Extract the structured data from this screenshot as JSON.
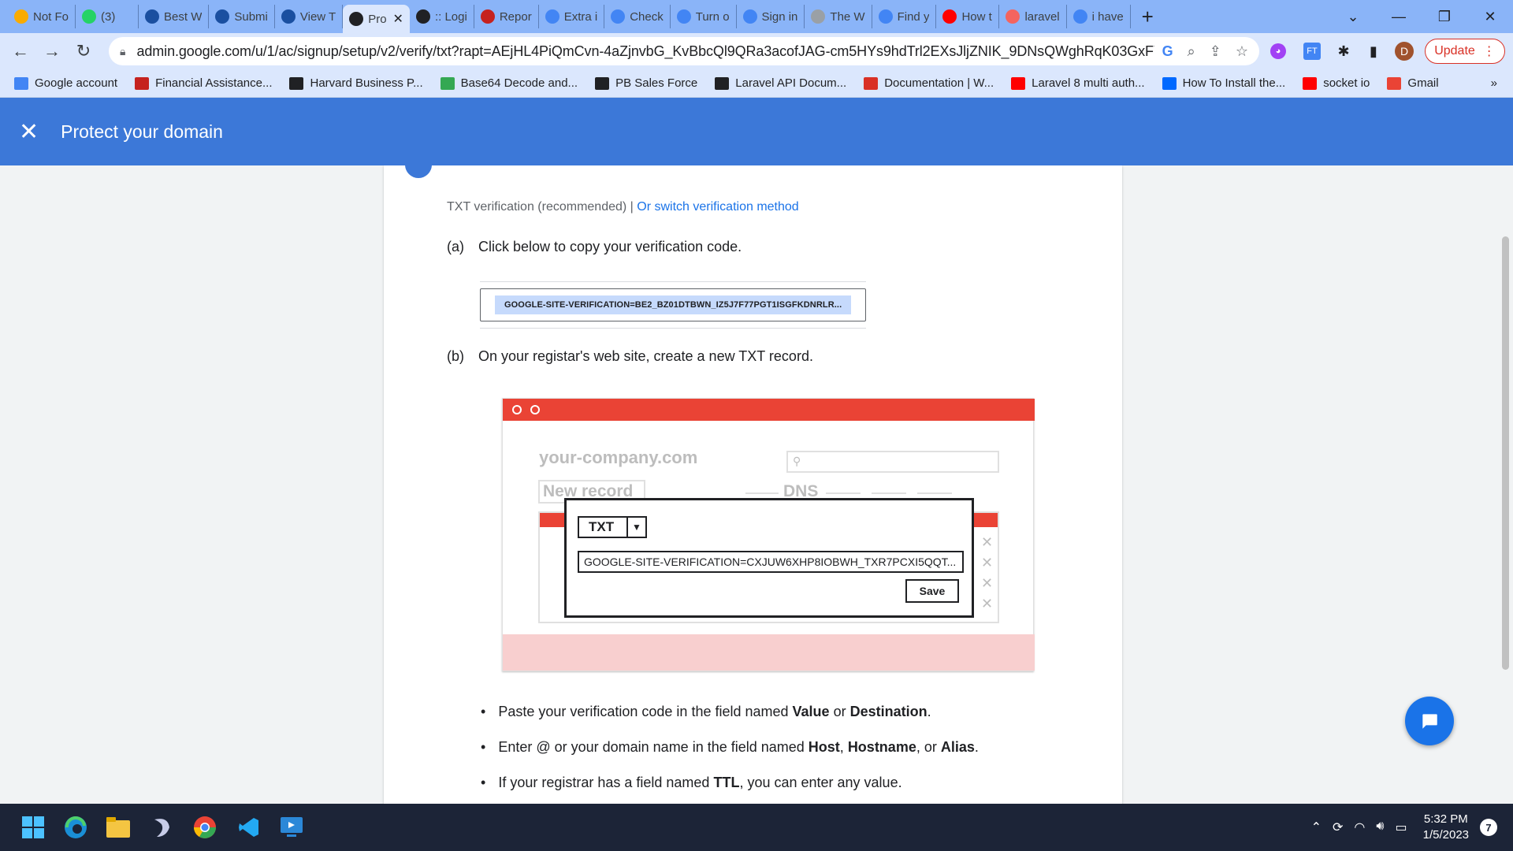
{
  "browser": {
    "tabs": [
      {
        "title": "Not Fo",
        "favicon": "w-icon",
        "color": "#f9ab00"
      },
      {
        "title": "(3)",
        "favicon": "whatsapp-icon",
        "color": "#25d366"
      },
      {
        "title": "Best W",
        "favicon": "hu-icon",
        "color": "#1a4fa0"
      },
      {
        "title": "Submi",
        "favicon": "hu-icon",
        "color": "#1a4fa0"
      },
      {
        "title": "View T",
        "favicon": "hu-icon",
        "color": "#1a4fa0"
      },
      {
        "title": "Pro",
        "favicon": "google-admin-icon",
        "color": "#202124",
        "active": true
      },
      {
        "title": ":: Logi",
        "favicon": "feather-icon",
        "color": "#202124"
      },
      {
        "title": "Repor",
        "favicon": "w-icon",
        "color": "#c5221f"
      },
      {
        "title": "Extra i",
        "favicon": "google-icon",
        "color": "#4285f4"
      },
      {
        "title": "Check",
        "favicon": "google-icon",
        "color": "#4285f4"
      },
      {
        "title": "Turn o",
        "favicon": "google-icon",
        "color": "#4285f4"
      },
      {
        "title": "Sign in",
        "favicon": "google-icon",
        "color": "#4285f4"
      },
      {
        "title": "The W",
        "favicon": "page-icon",
        "color": "#9aa0a6"
      },
      {
        "title": "Find y",
        "favicon": "google-icon",
        "color": "#4285f4"
      },
      {
        "title": "How t",
        "favicon": "youtube-icon",
        "color": "#ff0000"
      },
      {
        "title": "laravel",
        "favicon": "laravel-icon",
        "color": "#f4645f"
      },
      {
        "title": "i have",
        "favicon": "google-icon",
        "color": "#4285f4"
      }
    ],
    "url": "admin.google.com/u/1/ac/signup/setup/v2/verify/txt?rapt=AEjHL4PiQmCvn-4aZjnvbG_KvBbcQl9QRa3acofJAG-cm5HYs9hdTrl2EXsJljZNIK_9DNsQWghRqK03GxFY...",
    "update_label": "Update",
    "profile_initial": "D",
    "bookmarks": [
      {
        "label": "Google account",
        "icon": "google-icon",
        "color": "#4285f4"
      },
      {
        "label": "Financial Assistance...",
        "icon": "iba-icon",
        "color": "#c5221f"
      },
      {
        "label": "Harvard Business P...",
        "icon": "hb-icon",
        "color": "#202124"
      },
      {
        "label": "Base64 Decode and...",
        "icon": "b64-icon",
        "color": "#34a853"
      },
      {
        "label": "PB Sales Force",
        "icon": "pb-icon",
        "color": "#202124"
      },
      {
        "label": "Laravel API Docum...",
        "icon": "cd-icon",
        "color": "#202124"
      },
      {
        "label": "Documentation | W...",
        "icon": "swirl-icon",
        "color": "#d93025"
      },
      {
        "label": "Laravel 8 multi auth...",
        "icon": "youtube-icon",
        "color": "#ff0000"
      },
      {
        "label": "How To Install the...",
        "icon": "do-icon",
        "color": "#0069ff"
      },
      {
        "label": "socket io",
        "icon": "youtube-icon",
        "color": "#ff0000"
      },
      {
        "label": "Gmail",
        "icon": "gmail-icon",
        "color": "#ea4335"
      }
    ],
    "bookmarks_more": "»"
  },
  "header": {
    "title": "Protect your domain"
  },
  "content": {
    "verification_method": "TXT verification (recommended) |",
    "switch_link": "Or switch verification method",
    "step_a_label": "(a)",
    "step_a_text": "Click below to copy your verification code.",
    "verification_code": "GOOGLE-SITE-VERIFICATION=BE2_BZ01DTBWN_IZ5J7F77PGT1ISGFKDNRLR...",
    "step_b_label": "(b)",
    "step_b_text": "On your registar's web site, create a new TXT record.",
    "illustration": {
      "domain": "your-company.com",
      "new_record": "New record",
      "dns": "DNS",
      "record_type": "TXT",
      "record_value": "GOOGLE-SITE-VERIFICATION=CXJUW6XHP8IOBWH_TXR7PCXI5QQT...",
      "save_label": "Save"
    },
    "bullets": [
      {
        "pre": "Paste your verification code in the field named ",
        "b1": "Value",
        "mid": " or ",
        "b2": "Destination",
        "mid2": "",
        "b3": "",
        "post": "."
      },
      {
        "pre": "Enter @ or your domain name in the field named ",
        "b1": "Host",
        "mid": ", ",
        "b2": "Hostname",
        "mid2": ", or ",
        "b3": "Alias",
        "post": "."
      },
      {
        "pre": "If your registrar has a field named ",
        "b1": "TTL",
        "mid": ", you can enter any value.",
        "b2": "",
        "mid2": "",
        "b3": "",
        "post": ""
      }
    ]
  },
  "taskbar": {
    "time": "5:32 PM",
    "date": "1/5/2023",
    "notification_count": "7"
  }
}
